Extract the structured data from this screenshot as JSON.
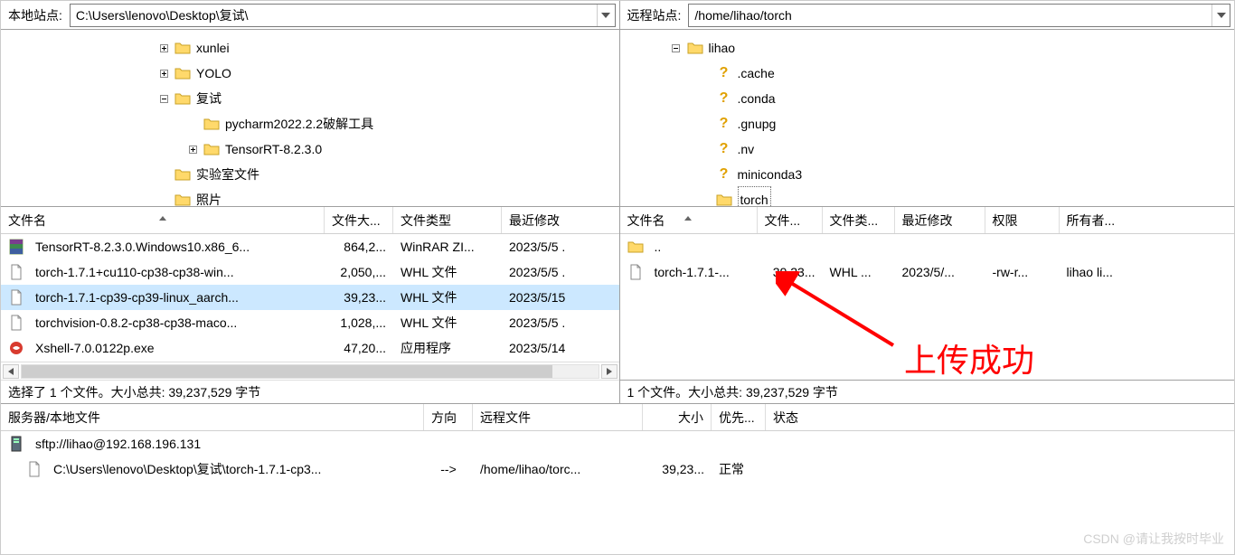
{
  "local": {
    "label": "本地站点:",
    "path": "C:\\Users\\lenovo\\Desktop\\复试\\",
    "tree": [
      {
        "indent": 168,
        "exp": "plus",
        "icon": "folder",
        "label": "xunlei"
      },
      {
        "indent": 168,
        "exp": "plus",
        "icon": "folder",
        "label": "YOLO"
      },
      {
        "indent": 168,
        "exp": "minus",
        "icon": "folder",
        "label": "复试"
      },
      {
        "indent": 200,
        "exp": "none",
        "icon": "folder",
        "label": "pycharm2022.2.2破解工具"
      },
      {
        "indent": 200,
        "exp": "plus",
        "icon": "folder",
        "label": "TensorRT-8.2.3.0"
      },
      {
        "indent": 168,
        "exp": "none",
        "icon": "folder",
        "label": "实验室文件"
      },
      {
        "indent": 168,
        "exp": "none",
        "icon": "folder",
        "label": "照片"
      }
    ],
    "cols": {
      "name": "文件名",
      "size": "文件大...",
      "type": "文件类型",
      "mod": "最近修改"
    },
    "files": [
      {
        "icon": "rar",
        "name": "TensorRT-8.2.3.0.Windows10.x86_6...",
        "size": "864,2...",
        "type": "WinRAR ZI...",
        "mod": "2023/5/5 .",
        "sel": false
      },
      {
        "icon": "whl",
        "name": "torch-1.7.1+cu110-cp38-cp38-win...",
        "size": "2,050,...",
        "type": "WHL 文件",
        "mod": "2023/5/5 .",
        "sel": false
      },
      {
        "icon": "whl",
        "name": "torch-1.7.1-cp39-cp39-linux_aarch...",
        "size": "39,23...",
        "type": "WHL 文件",
        "mod": "2023/5/15",
        "sel": true
      },
      {
        "icon": "whl",
        "name": "torchvision-0.8.2-cp38-cp38-maco...",
        "size": "1,028,...",
        "type": "WHL 文件",
        "mod": "2023/5/5 .",
        "sel": false
      },
      {
        "icon": "exe",
        "name": "Xshell-7.0.0122p.exe",
        "size": "47,20...",
        "type": "应用程序",
        "mod": "2023/5/14",
        "sel": false
      }
    ],
    "status": "选择了 1 个文件。大小总共: 39,237,529 字节"
  },
  "remote": {
    "label": "远程站点:",
    "path": "/home/lihao/torch",
    "tree": [
      {
        "indent": 50,
        "exp": "minus",
        "icon": "folder",
        "label": "lihao"
      },
      {
        "indent": 82,
        "exp": "none",
        "icon": "q",
        "label": ".cache"
      },
      {
        "indent": 82,
        "exp": "none",
        "icon": "q",
        "label": ".conda"
      },
      {
        "indent": 82,
        "exp": "none",
        "icon": "q",
        "label": ".gnupg"
      },
      {
        "indent": 82,
        "exp": "none",
        "icon": "q",
        "label": ".nv"
      },
      {
        "indent": 82,
        "exp": "none",
        "icon": "q",
        "label": "miniconda3"
      },
      {
        "indent": 82,
        "exp": "none",
        "icon": "folder",
        "label": "torch",
        "selected": true
      }
    ],
    "cols": {
      "name": "文件名",
      "size": "文件...",
      "type": "文件类...",
      "mod": "最近修改",
      "perm": "权限",
      "own": "所有者..."
    },
    "files": [
      {
        "icon": "folder",
        "name": "..",
        "size": "",
        "type": "",
        "mod": "",
        "perm": "",
        "own": ""
      },
      {
        "icon": "whl",
        "name": "torch-1.7.1-...",
        "size": "39,23...",
        "type": "WHL ...",
        "mod": "2023/5/...",
        "perm": "-rw-r...",
        "own": "lihao li..."
      }
    ],
    "status": "1 个文件。大小总共: 39,237,529 字节"
  },
  "queue": {
    "cols": {
      "local": "服务器/本地文件",
      "dir": "方向",
      "remote": "远程文件",
      "size": "大小",
      "pri": "优先...",
      "stat": "状态"
    },
    "rows": [
      {
        "icon": "server",
        "local": "sftp://lihao@192.168.196.131",
        "dir": "",
        "remote": "",
        "size": "",
        "pri": "",
        "stat": "",
        "indent": 0
      },
      {
        "icon": "file",
        "local": "C:\\Users\\lenovo\\Desktop\\复试\\torch-1.7.1-cp3...",
        "dir": "-->",
        "remote": "/home/lihao/torc...",
        "size": "39,23...",
        "pri": "正常",
        "stat": "",
        "indent": 20
      }
    ]
  },
  "annotation": "上传成功",
  "watermark": "CSDN @请让我按时毕业"
}
